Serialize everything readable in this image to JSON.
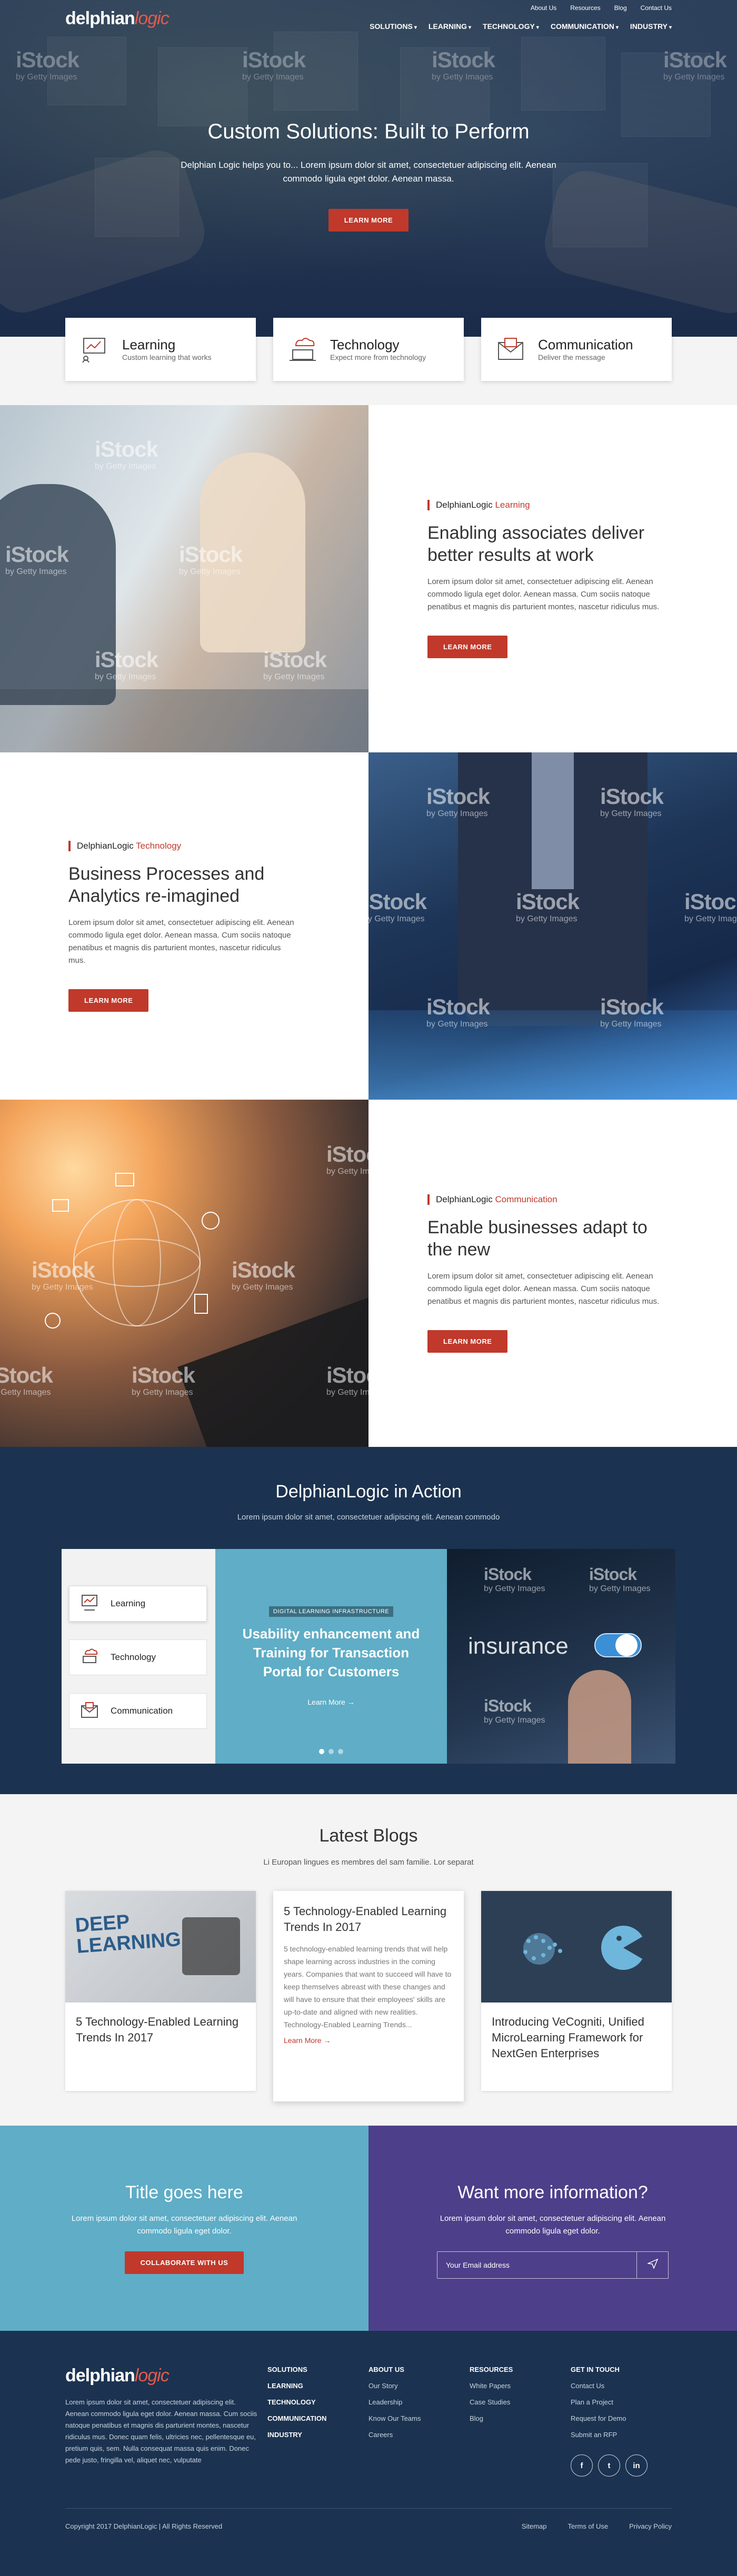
{
  "brand": {
    "name_main": "delphian",
    "name_accent": "logic"
  },
  "utility_nav": [
    "About Us",
    "Resources",
    "Blog",
    "Contact Us"
  ],
  "main_nav": [
    "SOLUTIONS",
    "LEARNING",
    "TECHNOLOGY",
    "COMMUNICATION",
    "INDUSTRY"
  ],
  "hero": {
    "title": "Custom Solutions: Built to Perform",
    "text": "Delphian Logic helps you to... Lorem ipsum dolor sit amet, consectetuer adipiscing elit. Aenean commodo ligula eget dolor. Aenean massa.",
    "button": "LEARN MORE"
  },
  "watermark": {
    "brand": "iStock",
    "sub": "by Getty Images"
  },
  "features": [
    {
      "title": "Learning",
      "sub": "Custom learning that works",
      "icon": "learning-board-icon"
    },
    {
      "title": "Technology",
      "sub": "Expect more from technology",
      "icon": "cloud-laptop-icon"
    },
    {
      "title": "Communication",
      "sub": "Deliver the message",
      "icon": "envelope-icon"
    }
  ],
  "sections": [
    {
      "kicker_main": "DelphianLogic ",
      "kicker_accent": "Learning",
      "title": "Enabling associates deliver better results at work",
      "text": "Lorem ipsum dolor sit amet, consectetuer adipiscing elit. Aenean commodo ligula eget dolor. Aenean massa. Cum sociis natoque penatibus et magnis dis parturient montes, nascetur ridiculus mus.",
      "button": "LEARN MORE"
    },
    {
      "kicker_main": "DelphianLogic ",
      "kicker_accent": "Technology",
      "title": "Business Processes and Analytics re-imagined",
      "text": "Lorem ipsum dolor sit amet, consectetuer adipiscing elit. Aenean commodo ligula eget dolor. Aenean massa. Cum sociis natoque penatibus et magnis dis parturient montes, nascetur ridiculus mus.",
      "button": "LEARN MORE"
    },
    {
      "kicker_main": "DelphianLogic ",
      "kicker_accent": "Communication",
      "title": "Enable businesses adapt to the new",
      "text": "Lorem ipsum dolor sit amet, consectetuer adipiscing elit. Aenean commodo ligula eget dolor. Aenean massa. Cum sociis natoque penatibus et magnis dis parturient montes, nascetur ridiculus mus.",
      "button": "LEARN MORE"
    }
  ],
  "action": {
    "title": "DelphianLogic in Action",
    "sub": "Lorem ipsum dolor sit amet, consectetuer adipiscing elit. Aenean commodo",
    "tabs": [
      "Learning",
      "Technology",
      "Communication"
    ],
    "slide_tag": "DIGITAL LEARNING INFRASTRUCTURE",
    "slide_title": "Usability enhancement and Training for Transaction Portal for Customers",
    "slide_link": "Learn More →",
    "image_word": "insurance"
  },
  "blogs": {
    "title": "Latest Blogs",
    "sub": "Li Europan lingues es membres del sam familie. Lor separat",
    "thumb_text": "DEEP LEARNING",
    "cards": [
      {
        "title": "5 Technology-Enabled Learning Trends In 2017"
      },
      {
        "title": "5 Technology-Enabled Learning Trends In 2017",
        "text": "5 technology-enabled learning trends that will help shape learning across industries in the coming years. Companies that want to succeed will have to keep themselves abreast with these changes and will have to ensure that their employees' skills are up-to-date and aligned with new realities. Technology-Enabled Learning Trends...",
        "link": "Learn More →"
      },
      {
        "title": "Introducing VeCogniti, Unified MicroLearning Framework for NextGen Enterprises"
      }
    ]
  },
  "cta": {
    "left": {
      "title": "Title goes here",
      "text": "Lorem ipsum dolor sit amet, consectetuer adipiscing elit. Aenean commodo ligula eget dolor.",
      "button": "COLLABORATE WITH US"
    },
    "right": {
      "title": "Want more information?",
      "text": "Lorem ipsum dolor sit amet, consectetuer adipiscing elit. Aenean commodo ligula eget dolor.",
      "placeholder": "Your Email address"
    }
  },
  "footer": {
    "about": "Lorem ipsum dolor sit amet, consectetuer adipiscing elit. Aenean commodo ligula eget dolor. Aenean massa. Cum sociis natoque penatibus et magnis dis parturient montes, nascetur ridiculus mus. Donec quam felis, ultricies nec, pellentesque eu, pretium quis, sem. Nulla consequat massa quis enim. Donec pede justo, fringilla vel, aliquet nec, vulputate",
    "col1": [
      "SOLUTIONS",
      "LEARNING",
      "TECHNOLOGY",
      "COMMUNICATION",
      "INDUSTRY"
    ],
    "col2": {
      "title": "ABOUT US",
      "items": [
        "Our Story",
        "Leadership",
        "Know Our Teams",
        "Careers"
      ]
    },
    "col3": {
      "title": "RESOURCES",
      "items": [
        "White Papers",
        "Case Studies",
        "Blog"
      ]
    },
    "col4": {
      "title": "GET IN TOUCH",
      "items": [
        "Contact Us",
        "Plan a Project",
        "Request for Demo",
        "Submit an RFP"
      ]
    },
    "social": [
      "f",
      "t",
      "in"
    ],
    "copyright": "Copyright 2017 DelphianLogic | All Rights Reserved",
    "links": [
      "Sitemap",
      "Terms of Use",
      "Privacy Policy"
    ]
  },
  "colors": {
    "accent": "#c0392b",
    "navy": "#1b3350",
    "teal": "#5fadc6",
    "purple": "#4e3f8a"
  }
}
